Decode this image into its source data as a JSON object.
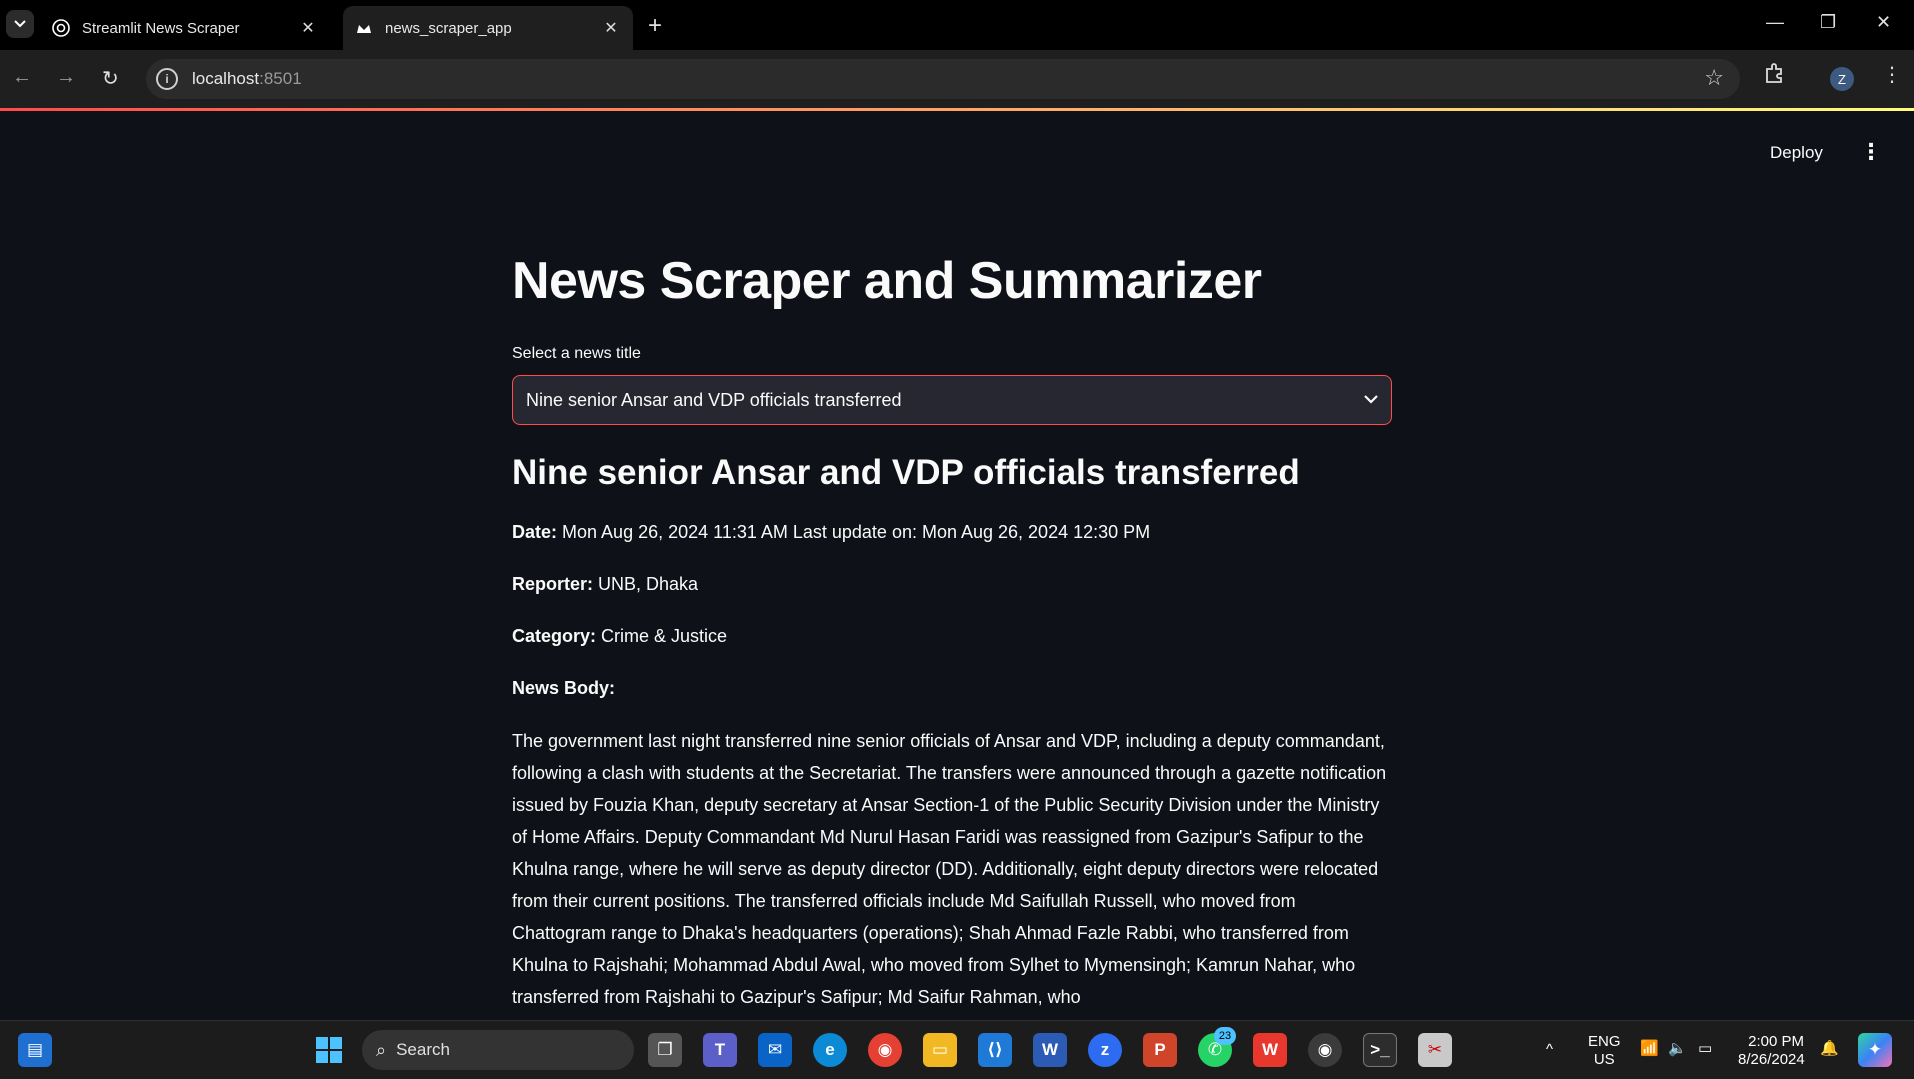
{
  "browser": {
    "tabs": [
      {
        "title": "Streamlit News Scraper",
        "icon": "chatgpt-icon"
      },
      {
        "title": "news_scraper_app",
        "icon": "streamlit-crown-icon"
      }
    ],
    "url_host": "localhost",
    "url_port": ":8501"
  },
  "header": {
    "deploy_label": "Deploy"
  },
  "main": {
    "title": "News Scraper and Summarizer",
    "select_label": "Select a news title",
    "select_value": "Nine senior Ansar and VDP officials transferred",
    "article_title": "Nine senior Ansar and VDP officials transferred",
    "date_label": "Date:",
    "date_value": "Mon Aug 26, 2024 11:31 AM Last update on: Mon Aug 26, 2024 12:30 PM",
    "reporter_label": "Reporter:",
    "reporter_value": "UNB, Dhaka",
    "category_label": "Category:",
    "category_value": "Crime & Justice",
    "body_label": "News Body:",
    "body_text": "The government last night transferred nine senior officials of Ansar and VDP, including a deputy commandant, following a clash with students at the Secretariat. The transfers were announced through a gazette notification issued by Fouzia Khan, deputy secretary at Ansar Section-1 of the Public Security Division under the Ministry of Home Affairs. Deputy Commandant Md Nurul Hasan Faridi was reassigned from Gazipur's Safipur to the Khulna range, where he will serve as deputy director (DD). Additionally, eight deputy directors were relocated from their current positions. The transferred officials include Md Saifullah Russell, who moved from Chattogram range to Dhaka's headquarters (operations); Shah Ahmad Fazle Rabbi, who transferred from Khulna to Rajshahi; Mohammad Abdul Awal, who moved from Sylhet to Mymensingh; Kamrun Nahar, who transferred from Rajshahi to Gazipur's Safipur; Md Saifur Rahman, who"
  },
  "taskbar": {
    "search_placeholder": "Search",
    "whatsapp_badge": "23",
    "lang_line1": "ENG",
    "lang_line2": "US",
    "time": "2:00 PM",
    "date": "8/26/2024"
  }
}
